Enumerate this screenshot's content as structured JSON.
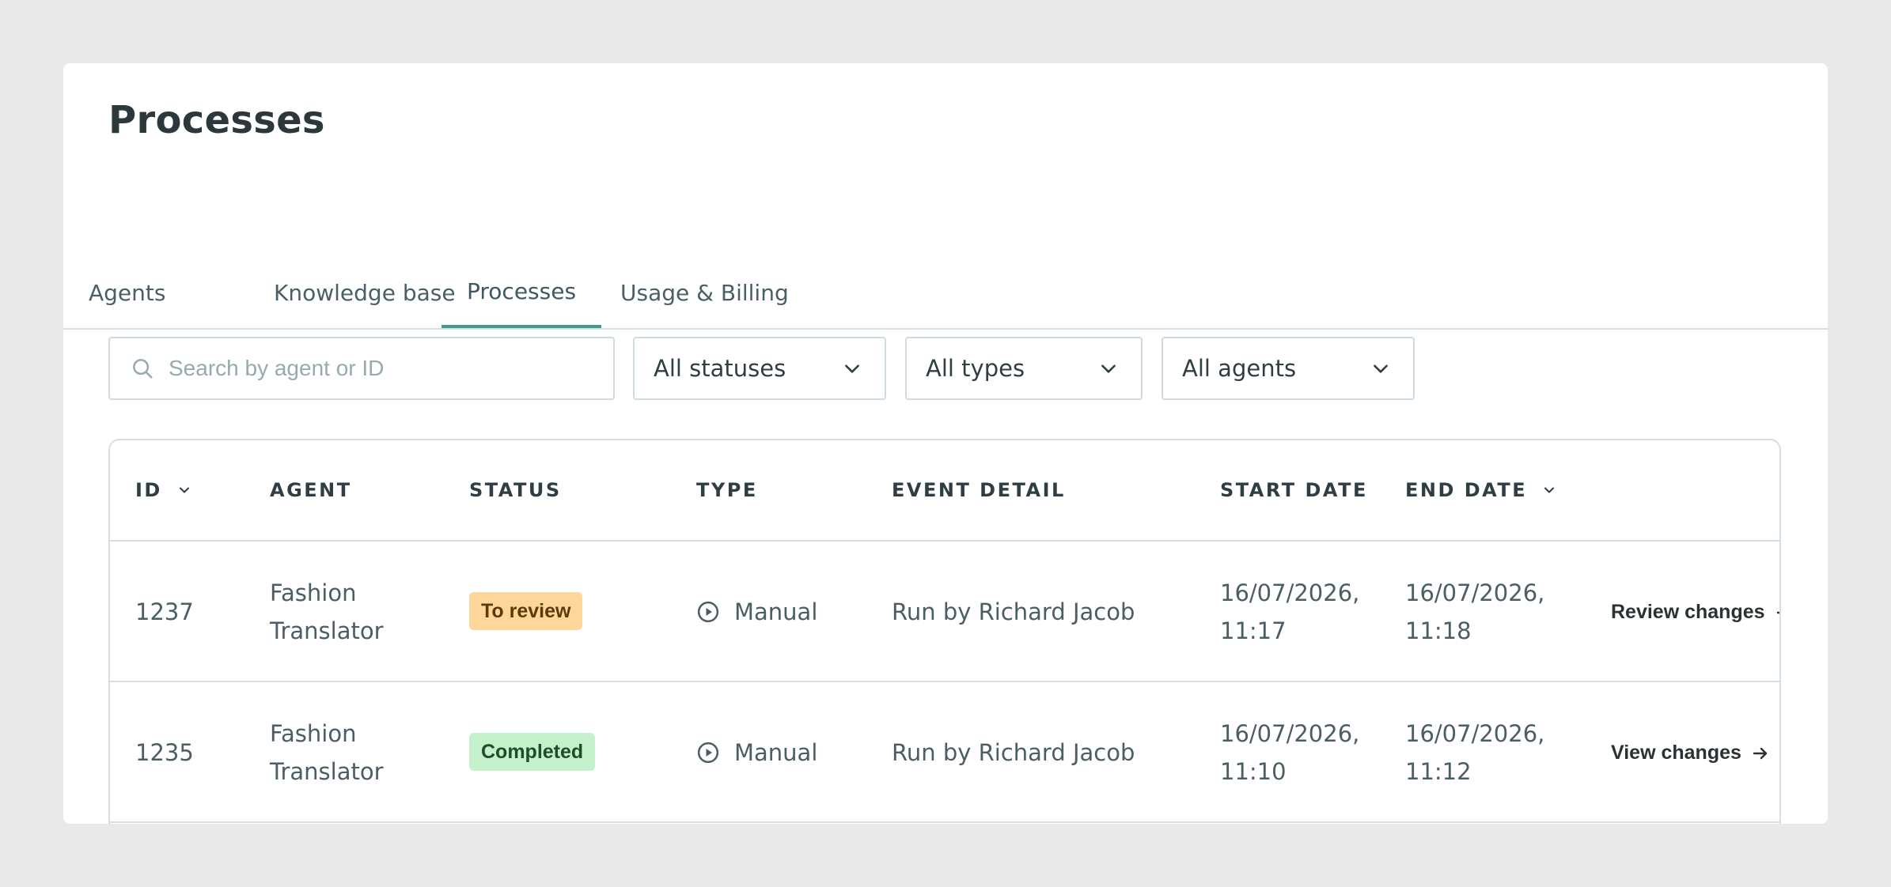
{
  "page": {
    "title": "Processes"
  },
  "tabs": [
    {
      "label": "Agents",
      "active": false
    },
    {
      "label": "Knowledge base",
      "active": false
    },
    {
      "label": "Processes",
      "active": true
    },
    {
      "label": "Usage & Billing",
      "active": false
    }
  ],
  "filters": {
    "search_placeholder": "Search by agent or ID",
    "search_value": "",
    "status": "All statuses",
    "type": "All types",
    "agent": "All agents"
  },
  "table": {
    "columns": [
      "ID",
      "AGENT",
      "STATUS",
      "TYPE",
      "EVENT DETAIL",
      "START DATE",
      "END DATE"
    ],
    "rows": [
      {
        "id": "1237",
        "agent_line1": "Fashion",
        "agent_line2": "Translator",
        "status": "To review",
        "type": "Manual",
        "event": "Run by Richard Jacob",
        "start_line1": "16/07/2026,",
        "start_line2": "11:17",
        "end_line1": "16/07/2026,",
        "end_line2": "11:18",
        "action": "Review changes"
      },
      {
        "id": "1235",
        "agent_line1": "Fashion",
        "agent_line2": "Translator",
        "status": "Completed",
        "type": "Manual",
        "event": "Run by Richard Jacob",
        "start_line1": "16/07/2026,",
        "start_line2": "11:10",
        "end_line1": "16/07/2026,",
        "end_line2": "11:12",
        "action": "View changes"
      }
    ]
  },
  "colors": {
    "accent": "#3f9b8c",
    "badge_review": "#ffd699",
    "badge_completed": "#c4f0cc"
  },
  "icons": [
    "search-icon",
    "chevron-down-icon",
    "play-circle-icon",
    "arrow-right-icon"
  ]
}
